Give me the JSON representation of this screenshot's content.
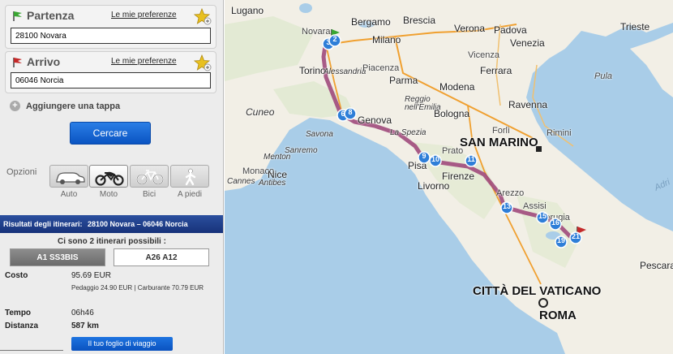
{
  "departure": {
    "title": "Partenza",
    "preferences_link": "Le mie preferenze",
    "value": "28100 Novara"
  },
  "arrival": {
    "title": "Arrivo",
    "preferences_link": "Le mie preferenze",
    "value": "06046 Norcia"
  },
  "add_stop": "Aggiungere una tappa",
  "search_button": "Cercare",
  "options": {
    "label": "Opzioni",
    "modes": [
      {
        "label": "Auto",
        "icon": "car-icon"
      },
      {
        "label": "Moto",
        "icon": "motorbike-icon",
        "selected": true
      },
      {
        "label": "Bici",
        "icon": "bicycle-icon"
      },
      {
        "label": "A piedi",
        "icon": "pedestrian-icon"
      }
    ]
  },
  "results": {
    "header_label": "Risultati degli itinerari:",
    "header_route": "28100 Novara – 06046 Norcia",
    "count_text": "Ci sono 2 itinerari possibili :",
    "tabs": [
      "A1 SS3BIS",
      "A26 A12"
    ],
    "cost_label": "Costo",
    "cost_value": "95.69 EUR",
    "cost_detail": "Pedaggio 24.90 EUR | Carburante 70.79 EUR",
    "time_label": "Tempo",
    "time_value": "06h46",
    "distance_label": "Distanza",
    "distance_value": "587 km",
    "sheet_button": "Il tuo foglio di viaggio"
  },
  "map": {
    "cities": [
      "Bergamo",
      "Brescia",
      "Verona",
      "Padova",
      "Venezia",
      "Trieste",
      "Novara",
      "Milano",
      "Torino",
      "Alessandria",
      "Piacenza",
      "Parma",
      "Modena",
      "Ferrara",
      "Vicenza",
      "Pula",
      "Cuneo",
      "Genova",
      "Reggio nell'Emilia",
      "Bologna",
      "Ravenna",
      "La Spezia",
      "Savona",
      "Sanremo",
      "Monaco",
      "Nice",
      "Antibes",
      "Cannes",
      "Menton",
      "Pisa",
      "Livorno",
      "Prato",
      "Firenze",
      "Forlì",
      "Rimini",
      "SAN MARINO",
      "Perugia",
      "Assisi",
      "Arezzo",
      "Pescara",
      "CITTÀ DEL VATICANO",
      "ROMA",
      "Adri"
    ],
    "markers": [
      "3",
      "2",
      "6",
      "8",
      "9",
      "10",
      "11",
      "13",
      "15",
      "16",
      "19",
      "21"
    ]
  },
  "colors": {
    "route": "#a04a7c",
    "sea": "#a9cde8",
    "land": "#f2efe6",
    "marker": "#2e7ed8"
  }
}
